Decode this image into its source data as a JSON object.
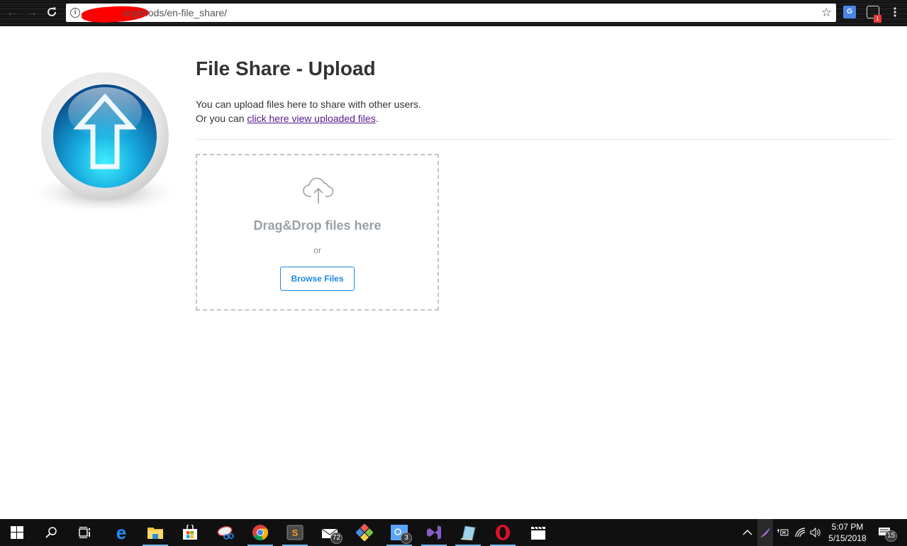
{
  "browser": {
    "url": "org/mods/en-file_share/",
    "back_icon": "←",
    "forward_icon": "→",
    "reload_icon": "C",
    "info_icon": "i",
    "star_icon": "☆",
    "translate_icon": "G",
    "extension_badge": "1",
    "menu_icon": "⋮"
  },
  "page": {
    "title": "File Share - Upload",
    "intro_line1": "You can upload files here to share with other users.",
    "intro_line2_prefix": "Or you can ",
    "intro_link": "click here view uploaded files",
    "intro_line2_suffix": "."
  },
  "dropzone": {
    "title": "Drag&Drop files here",
    "or_text": "or",
    "browse_label": "Browse Files"
  },
  "taskbar": {
    "apps": [
      {
        "name": "start",
        "badge": null
      },
      {
        "name": "search",
        "badge": null
      },
      {
        "name": "task-view",
        "badge": null
      },
      {
        "name": "edge",
        "badge": null
      },
      {
        "name": "file-explorer",
        "badge": null
      },
      {
        "name": "store",
        "badge": null
      },
      {
        "name": "snipping-tool",
        "badge": null
      },
      {
        "name": "chrome",
        "badge": null
      },
      {
        "name": "sublime-text",
        "badge": null
      },
      {
        "name": "mail",
        "badge": "72"
      },
      {
        "name": "git-app",
        "badge": null
      },
      {
        "name": "messaging-app",
        "badge": "3"
      },
      {
        "name": "visual-studio",
        "badge": null
      },
      {
        "name": "notepad",
        "badge": null
      },
      {
        "name": "opera",
        "badge": null
      },
      {
        "name": "video-editor",
        "badge": null
      }
    ],
    "time": "5:07 PM",
    "date": "5/15/2018",
    "notifications_count": "15"
  }
}
